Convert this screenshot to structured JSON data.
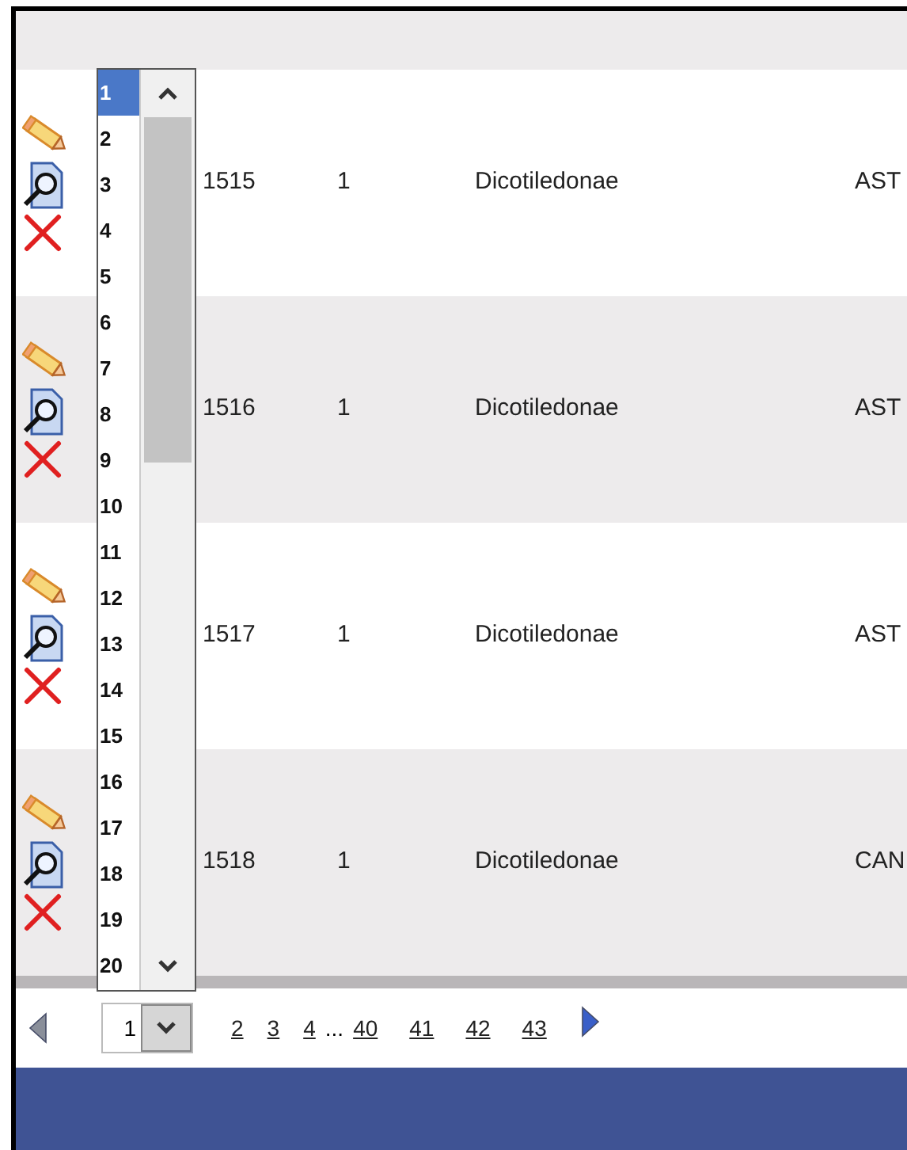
{
  "rows": [
    {
      "id": "1515",
      "column_2": "1",
      "column_3": "Dicotiledonae",
      "column_4": "AST"
    },
    {
      "id": "1516",
      "column_2": "1",
      "column_3": "Dicotiledonae",
      "column_4": "AST"
    },
    {
      "id": "1517",
      "column_2": "1",
      "column_3": "Dicotiledonae",
      "column_4": "AST"
    },
    {
      "id": "1518",
      "column_2": "1",
      "column_3": "Dicotiledonae",
      "column_4": "CAN"
    }
  ],
  "page_dropdown": {
    "value": "1",
    "expanded": true,
    "options": [
      {
        "label": "1",
        "selected": true
      },
      {
        "label": "2",
        "selected": false
      },
      {
        "label": "3",
        "selected": false
      },
      {
        "label": "4",
        "selected": false
      },
      {
        "label": "5",
        "selected": false
      },
      {
        "label": "6",
        "selected": false
      },
      {
        "label": "7",
        "selected": false
      },
      {
        "label": "8",
        "selected": false
      },
      {
        "label": "9",
        "selected": false
      },
      {
        "label": "10",
        "selected": false
      },
      {
        "label": "11",
        "selected": false
      },
      {
        "label": "12",
        "selected": false
      },
      {
        "label": "13",
        "selected": false
      },
      {
        "label": "14",
        "selected": false
      },
      {
        "label": "15",
        "selected": false
      },
      {
        "label": "16",
        "selected": false
      },
      {
        "label": "17",
        "selected": false
      },
      {
        "label": "18",
        "selected": false
      },
      {
        "label": "19",
        "selected": false
      },
      {
        "label": "20",
        "selected": false
      }
    ]
  },
  "pager": {
    "pages": [
      "2",
      "3",
      "4"
    ],
    "ellipsis": "...",
    "last_pages": [
      "40",
      "41",
      "42",
      "43"
    ]
  }
}
